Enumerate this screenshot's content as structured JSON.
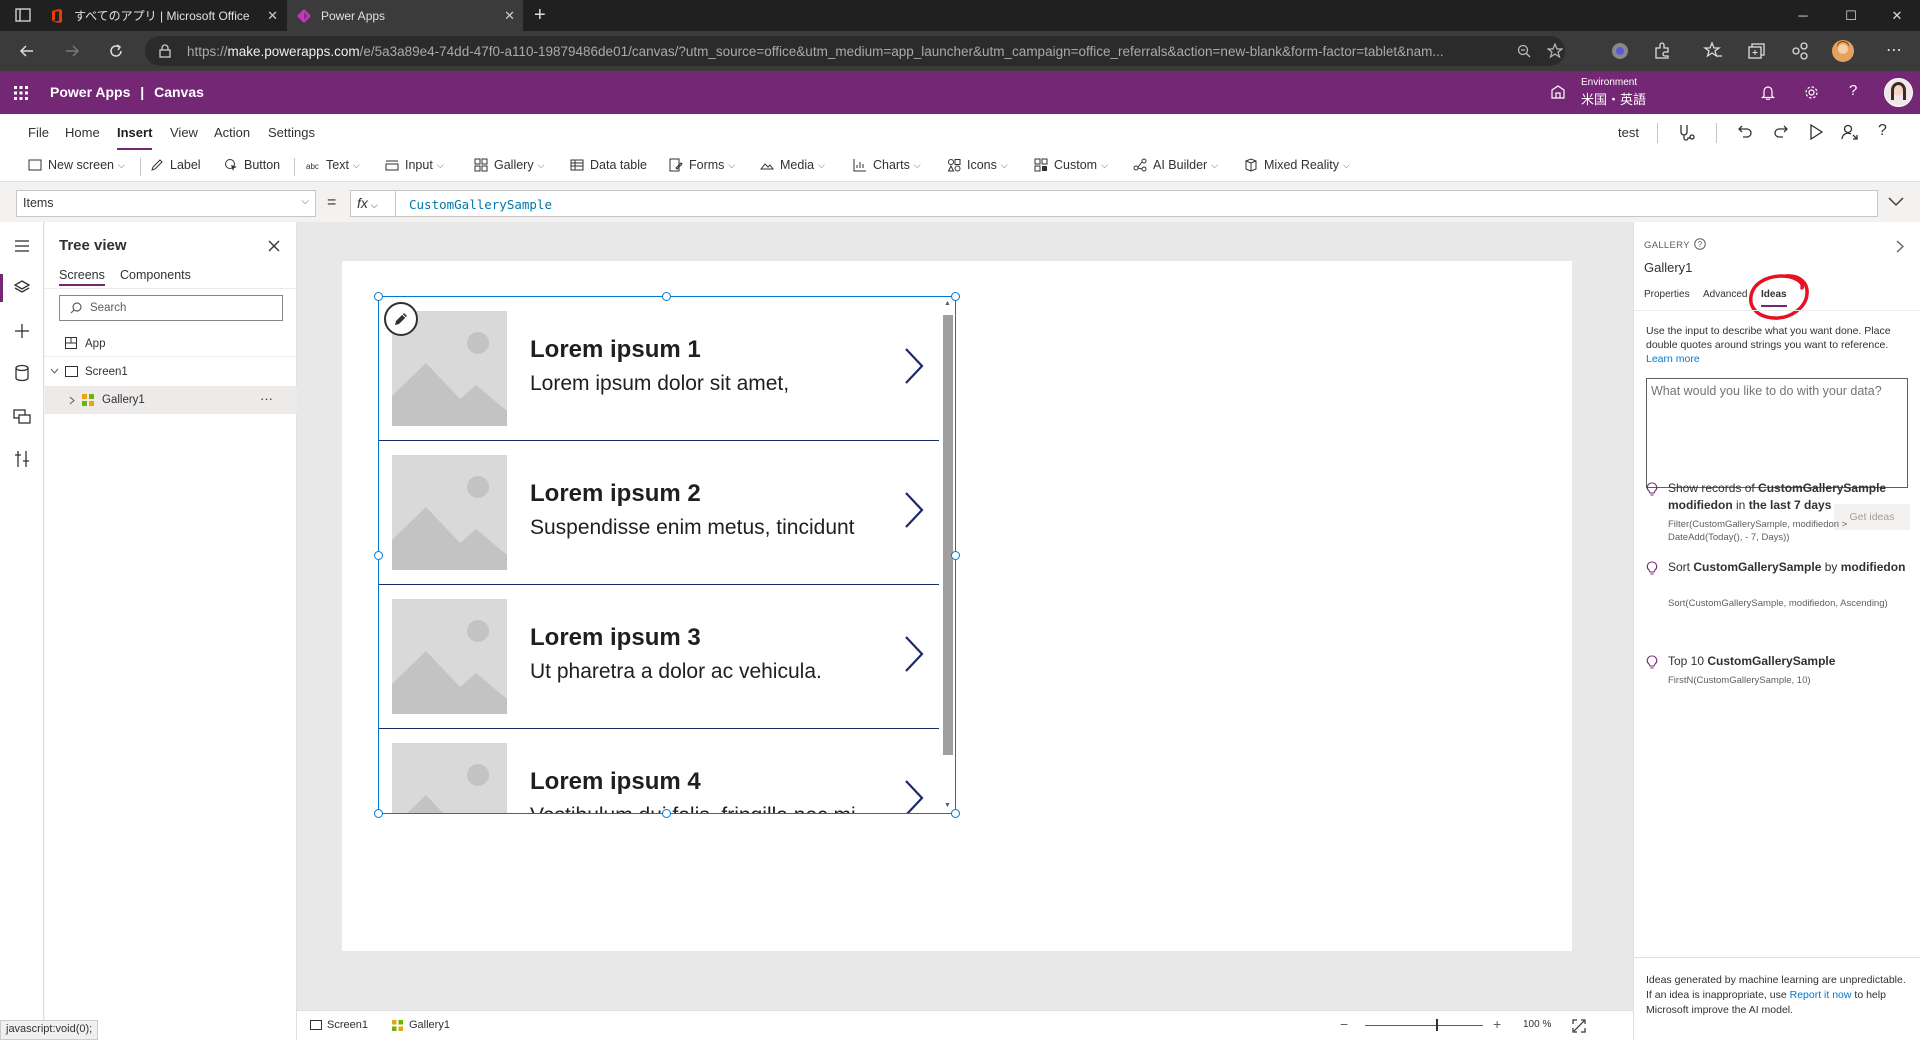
{
  "browser": {
    "tabs": [
      {
        "title": "すべてのアプリ | Microsoft Office",
        "active": false
      },
      {
        "title": "Power Apps",
        "active": true
      }
    ],
    "new_tab": "+",
    "window": {
      "minimize": "─",
      "maximize": "☐",
      "close": "✕"
    },
    "url_prefix": "https://",
    "url_host": "make.powerapps.com",
    "url_path": "/e/5a3a89e4-74dd-47f0-a110-19879486de01/canvas/?utm_source=office&utm_medium=app_launcher&utm_campaign=office_referrals&action=new-blank&form-factor=tablet&nam...",
    "status_text": "javascript:void(0);"
  },
  "app": {
    "product": "Power Apps",
    "separator": "|",
    "mode": "Canvas",
    "environment_label": "Environment",
    "environment_value": "米国・英語"
  },
  "menu": {
    "items": [
      "File",
      "Home",
      "Insert",
      "View",
      "Action",
      "Settings"
    ],
    "active": "Insert",
    "app_name": "test"
  },
  "ribbon": {
    "new_screen": "New screen",
    "label": "Label",
    "button": "Button",
    "text": "Text",
    "input": "Input",
    "gallery": "Gallery",
    "data_table": "Data table",
    "forms": "Forms",
    "media": "Media",
    "charts": "Charts",
    "icons": "Icons",
    "custom": "Custom",
    "ai_builder": "AI Builder",
    "mixed_reality": "Mixed Reality"
  },
  "formula": {
    "property": "Items",
    "equals": "=",
    "fx": "fx",
    "value": "CustomGallerySample"
  },
  "tree": {
    "title": "Tree view",
    "tabs": [
      "Screens",
      "Components"
    ],
    "active_tab": "Screens",
    "search_placeholder": "Search",
    "nodes": {
      "app": "App",
      "screen": "Screen1",
      "gallery": "Gallery1",
      "more": "···"
    }
  },
  "gallery": {
    "items": [
      {
        "title": "Lorem ipsum 1",
        "subtitle": "Lorem ipsum dolor sit amet,"
      },
      {
        "title": "Lorem ipsum 2",
        "subtitle": "Suspendisse enim metus, tincidunt"
      },
      {
        "title": "Lorem ipsum 3",
        "subtitle": "Ut pharetra a dolor ac vehicula."
      },
      {
        "title": "Lorem ipsum 4",
        "subtitle": "Vestibulum dui felis, fringilla nec mi"
      }
    ]
  },
  "statusbar": {
    "screen": "Screen1",
    "gallery": "Gallery1",
    "zoom_minus": "−",
    "zoom_plus": "+",
    "zoom_level": "100 %"
  },
  "panel": {
    "control_type": "GALLERY",
    "control_name": "Gallery1",
    "tabs": [
      "Properties",
      "Advanced",
      "Ideas"
    ],
    "active_tab": "Ideas",
    "description": "Use the input to describe what you want done. Place double quotes around strings you want to reference.",
    "learn_more": "Learn more",
    "input_placeholder": "What would you like to do with your data?",
    "get_ideas": "Get ideas",
    "ideas": [
      {
        "parts": [
          [
            "Show records of ",
            false
          ],
          [
            "CustomGallerySample modifiedon",
            true
          ],
          [
            " in ",
            false
          ],
          [
            "the last 7 days",
            true
          ]
        ],
        "code": "Filter(CustomGallerySample, modifiedon > DateAdd(Today(), - 7, Days))"
      },
      {
        "parts": [
          [
            "Sort ",
            false
          ],
          [
            "CustomGallerySample",
            true
          ],
          [
            " by ",
            false
          ],
          [
            "modifiedon",
            true
          ]
        ],
        "code": "Sort(CustomGallerySample, modifiedon, Ascending)"
      },
      {
        "parts": [
          [
            "Top 10 ",
            false
          ],
          [
            "CustomGallerySample",
            true
          ]
        ],
        "code": "FirstN(CustomGallerySample, 10)"
      }
    ],
    "footer_text": "Ideas generated by machine learning are unpredictable. If an idea is inappropriate, use",
    "footer_link": "Report it now",
    "footer_tail": "to help Microsoft improve the AI model."
  },
  "colors": {
    "brand": "#742774",
    "selection": "#0078d4",
    "annotation": "#e81123"
  }
}
